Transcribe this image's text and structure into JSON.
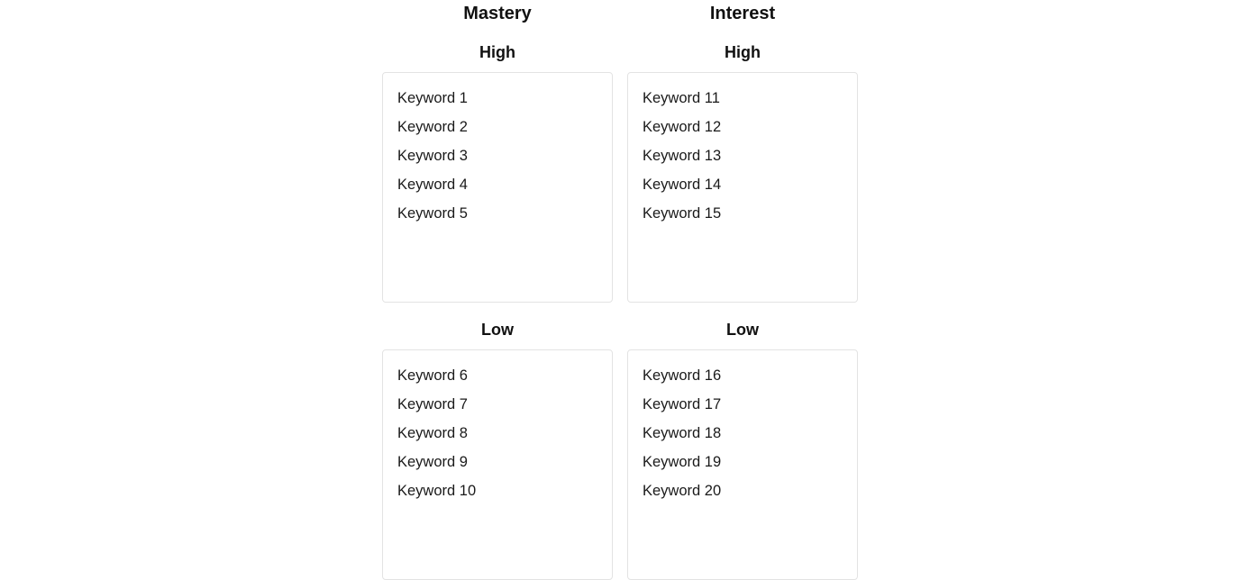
{
  "columns": [
    {
      "title": "Mastery",
      "high": {
        "label": "High",
        "keywords": [
          "Keyword 1",
          "Keyword 2",
          "Keyword 3",
          "Keyword 4",
          "Keyword 5"
        ]
      },
      "low": {
        "label": "Low",
        "keywords": [
          "Keyword 6",
          "Keyword 7",
          "Keyword 8",
          "Keyword 9",
          "Keyword 10"
        ]
      }
    },
    {
      "title": "Interest",
      "high": {
        "label": "High",
        "keywords": [
          "Keyword 11",
          "Keyword 12",
          "Keyword 13",
          "Keyword 14",
          "Keyword 15"
        ]
      },
      "low": {
        "label": "Low",
        "keywords": [
          "Keyword 16",
          "Keyword 17",
          "Keyword 18",
          "Keyword 19",
          "Keyword 20"
        ]
      }
    }
  ]
}
